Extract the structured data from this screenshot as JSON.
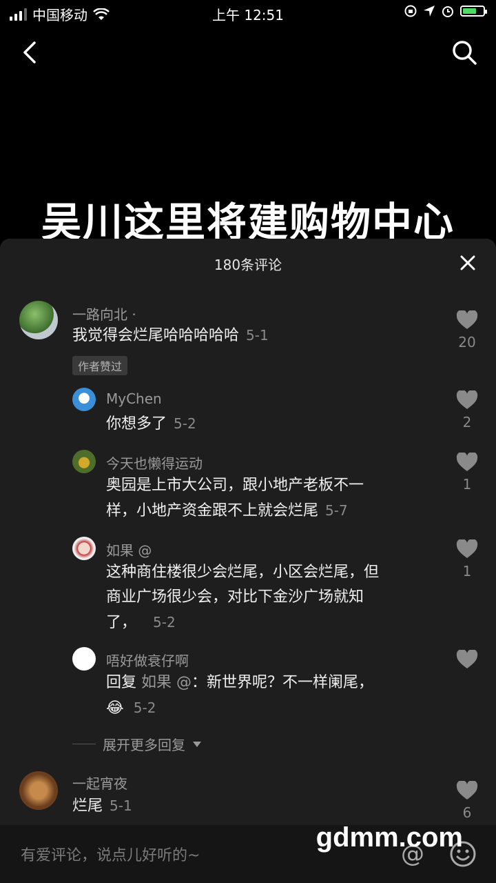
{
  "status_bar": {
    "carrier": "中国移动",
    "time": "上午 12:51"
  },
  "video": {
    "title": "吴川这里将建购物中心"
  },
  "comments_sheet": {
    "count_label": "180条评论",
    "comments": [
      {
        "user": "一路向北 ·",
        "text": "我觉得会烂尾哈哈哈哈哈",
        "date": "5-1",
        "likes": "20",
        "badge": "作者赞过"
      },
      {
        "user": "MyChen",
        "text": "你想多了",
        "date": "5-2",
        "likes": "2"
      },
      {
        "user": "今天也懒得运动",
        "text_line1": "奥园是上市大公司，跟小地产老板不一",
        "text_line2": "样，小地产资金跟不上就会烂尾",
        "date": "5-7",
        "likes": "1"
      },
      {
        "user": "如果 @",
        "text_line1": "这种商住楼很少会烂尾，小区会烂尾，但",
        "text_line2": "商业广场很少会，对比下金沙广场就知",
        "text_line3": "了，",
        "date": "5-2",
        "likes": "1"
      },
      {
        "user": "唔好做衰仔啊",
        "reply_prefix": "回复",
        "reply_to": "如果 @",
        "text": "：新世界呢？不一样阑尾，",
        "emoji": "😂",
        "date": "5-2",
        "likes": ""
      },
      {
        "user": "一起宵夜",
        "text": "烂尾",
        "date": "5-1",
        "likes": "6"
      }
    ],
    "expand_label": "展开更多回复"
  },
  "input": {
    "placeholder": "有爱评论，说点儿好听的~",
    "at_symbol": "@"
  },
  "watermark": "gdmm.com",
  "colors": {
    "sheet_bg": "#1e1e1e",
    "page_bg": "#000000",
    "secondary_text": "#9a9a9a"
  }
}
